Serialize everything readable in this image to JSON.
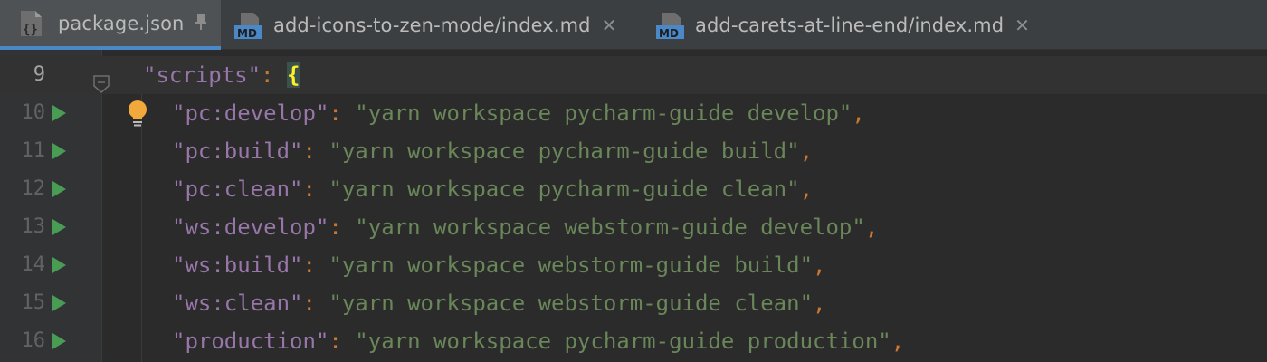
{
  "tabs": [
    {
      "label": "package.json",
      "icon": "json-file-icon",
      "active": true,
      "action": "pin-icon"
    },
    {
      "label": "add-icons-to-zen-mode/index.md",
      "icon": "markdown-file-icon",
      "icon_text": "MD",
      "active": false,
      "action": "close-icon"
    },
    {
      "label": "add-carets-at-line-end/index.md",
      "icon": "markdown-file-icon",
      "icon_text": "MD",
      "active": false,
      "action": "close-icon"
    }
  ],
  "editor": {
    "colors": {
      "key": "#9876aa",
      "string": "#6a8759",
      "punctuation": "#cc7832",
      "brace": "#ffef28",
      "run": "#499c54",
      "tab_underline": "#4a88c7"
    },
    "header": {
      "number": "9",
      "key": "\"scripts\"",
      "colon": ":",
      "brace": "{"
    },
    "lines": [
      {
        "number": "10",
        "key": "\"pc:develop\"",
        "colon": ":",
        "value": "\"yarn workspace pycharm-guide develop\"",
        "comma": ","
      },
      {
        "number": "11",
        "key": "\"pc:build\"",
        "colon": ":",
        "value": "\"yarn workspace pycharm-guide build\"",
        "comma": ","
      },
      {
        "number": "12",
        "key": "\"pc:clean\"",
        "colon": ":",
        "value": "\"yarn workspace pycharm-guide clean\"",
        "comma": ","
      },
      {
        "number": "13",
        "key": "\"ws:develop\"",
        "colon": ":",
        "value": "\"yarn workspace webstorm-guide develop\"",
        "comma": ","
      },
      {
        "number": "14",
        "key": "\"ws:build\"",
        "colon": ":",
        "value": "\"yarn workspace webstorm-guide build\"",
        "comma": ","
      },
      {
        "number": "15",
        "key": "\"ws:clean\"",
        "colon": ":",
        "value": "\"yarn workspace webstorm-guide clean\"",
        "comma": ","
      },
      {
        "number": "16",
        "key": "\"production\"",
        "colon": ":",
        "value": "\"yarn workspace pycharm-guide production\"",
        "comma": ","
      }
    ]
  }
}
